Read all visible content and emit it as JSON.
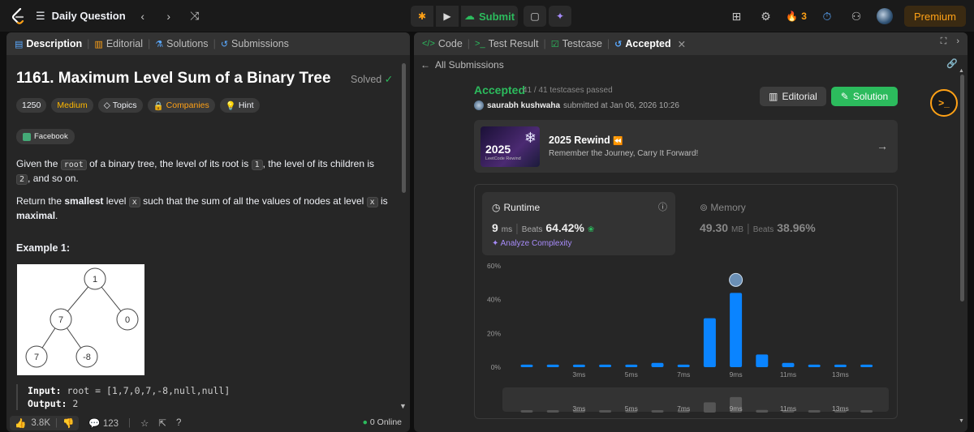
{
  "topbar": {
    "title": "Daily Question",
    "submit": "Submit",
    "streak": "3",
    "premium": "Premium"
  },
  "left_tabs": [
    {
      "label": "Description",
      "active": true
    },
    {
      "label": "Editorial",
      "active": false
    },
    {
      "label": "Solutions",
      "active": false
    },
    {
      "label": "Submissions",
      "active": false
    }
  ],
  "problem": {
    "title": "1161. Maximum Level Sum of a Binary Tree",
    "status": "Solved",
    "rating": "1250",
    "difficulty": "Medium",
    "tags": [
      "Topics",
      "Companies",
      "Hint"
    ],
    "company": "Facebook",
    "desc1": {
      "a": "Given the ",
      "root": "root",
      "b": " of a binary tree, the level of its root is ",
      "one": "1",
      "c": ", the level of its children is ",
      "two": "2",
      "d": ", and so on."
    },
    "desc2": {
      "a": "Return the ",
      "smallest": "smallest",
      "b": " level ",
      "x": "x",
      "c": " such that the sum of all the values of nodes at level ",
      "x2": "x",
      "d": " is ",
      "maximal": "maximal",
      "e": "."
    },
    "example_title": "Example 1:",
    "tree_nodes": [
      "1",
      "7",
      "0",
      "7",
      "-8"
    ],
    "input_label": "Input:",
    "input_value": "root = [1,7,0,7,-8,null,null]",
    "output_label": "Output:",
    "output_value": "2"
  },
  "left_bottom": {
    "likes": "3.8K",
    "comments": "123",
    "online": "0 Online"
  },
  "right_tabs": [
    {
      "label": "Code",
      "active": false
    },
    {
      "label": "Test Result",
      "active": false
    },
    {
      "label": "Testcase",
      "active": false
    },
    {
      "label": "Accepted",
      "active": true
    }
  ],
  "submission": {
    "back": "All Submissions",
    "status": "Accepted",
    "passed": "41 / 41 testcases passed",
    "user": "saurabh kushwaha",
    "submitted": "submitted at Jan 06, 2026 10:26",
    "editorial_btn": "Editorial",
    "solution_btn": "Solution"
  },
  "rewind": {
    "year": "2025",
    "sub": "LeetCode Rewind",
    "title": "2025 Rewind",
    "desc": "Remember the Journey, Carry It Forward!"
  },
  "runtime": {
    "label": "Runtime",
    "value": "9",
    "unit": "ms",
    "beats_label": "Beats",
    "beats": "64.42%",
    "analyze": "Analyze Complexity"
  },
  "memory": {
    "label": "Memory",
    "value": "49.30",
    "unit": "MB",
    "beats_label": "Beats",
    "beats": "38.96%"
  },
  "chart_data": {
    "type": "bar",
    "x": [
      1,
      2,
      3,
      4,
      5,
      6,
      7,
      8,
      9,
      10,
      11,
      12,
      13,
      14
    ],
    "values": [
      1.5,
      1.5,
      1.5,
      1.5,
      1.5,
      2.5,
      1.5,
      29,
      44,
      7.5,
      2.5,
      1.5,
      1.5,
      1.5
    ],
    "ytick_labels": [
      "0%",
      "20%",
      "40%",
      "60%"
    ],
    "xtick_labels": [
      "3ms",
      "5ms",
      "7ms",
      "9ms",
      "11ms",
      "13ms"
    ],
    "ylim": [
      0,
      60
    ],
    "highlight_x": 9,
    "bar_color": "#0a84ff",
    "overview_labels": [
      "3ms",
      "5ms",
      "7ms",
      "9ms",
      "11ms",
      "13ms"
    ]
  },
  "colors": {
    "accent_green": "#2cbb5d",
    "accent_orange": "#ffa116",
    "bar_blue": "#0a84ff"
  }
}
